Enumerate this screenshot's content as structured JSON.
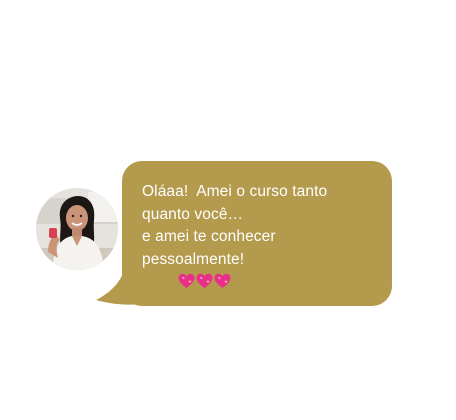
{
  "chat": {
    "message": {
      "lines": [
        "Oláaa!  Amei o curso tanto",
        "quanto você…",
        "e amei te conhecer",
        "pessoalmente!"
      ],
      "trailing_emoji": [
        "sparkling-heart-icon",
        "sparkling-heart-icon",
        "sparkling-heart-icon"
      ]
    },
    "avatar_icon": "person-avatar"
  },
  "colors": {
    "bubble": "#b49a4c",
    "text": "#ffffff",
    "heart": "#e8308a"
  }
}
